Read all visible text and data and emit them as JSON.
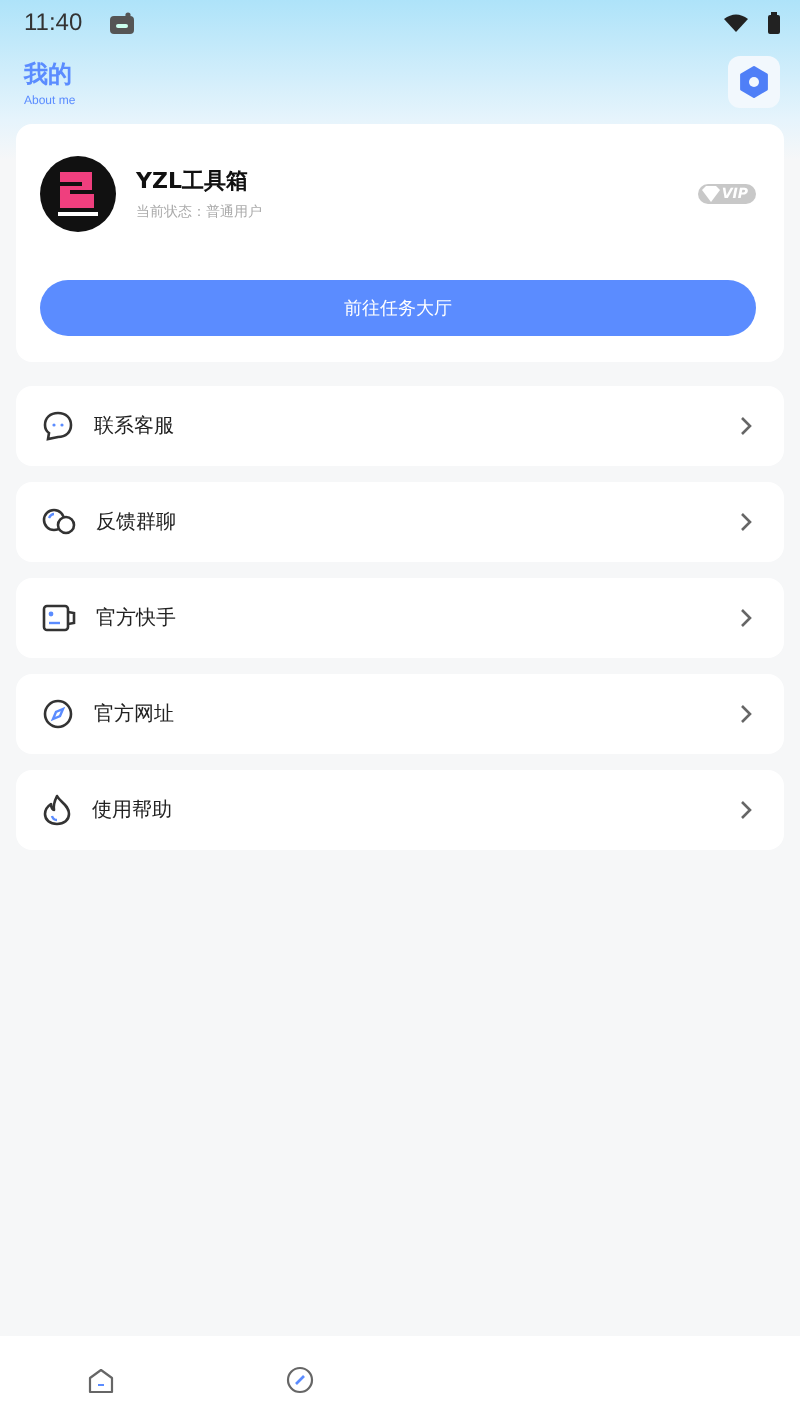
{
  "status_bar": {
    "time": "11:40"
  },
  "header": {
    "title": "我的",
    "subtitle": "About me"
  },
  "profile": {
    "name": "YZL工具箱",
    "status": "当前状态：普通用户",
    "badge": "VIP",
    "button": "前往任务大厅"
  },
  "menu": [
    {
      "label": "联系客服",
      "kind": "chat"
    },
    {
      "label": "反馈群聊",
      "kind": "group"
    },
    {
      "label": "官方快手",
      "kind": "video"
    },
    {
      "label": "官方网址",
      "kind": "compass"
    },
    {
      "label": "使用帮助",
      "kind": "flame"
    }
  ],
  "bottom_nav": [
    {
      "kind": "home"
    },
    {
      "kind": "compass"
    }
  ]
}
